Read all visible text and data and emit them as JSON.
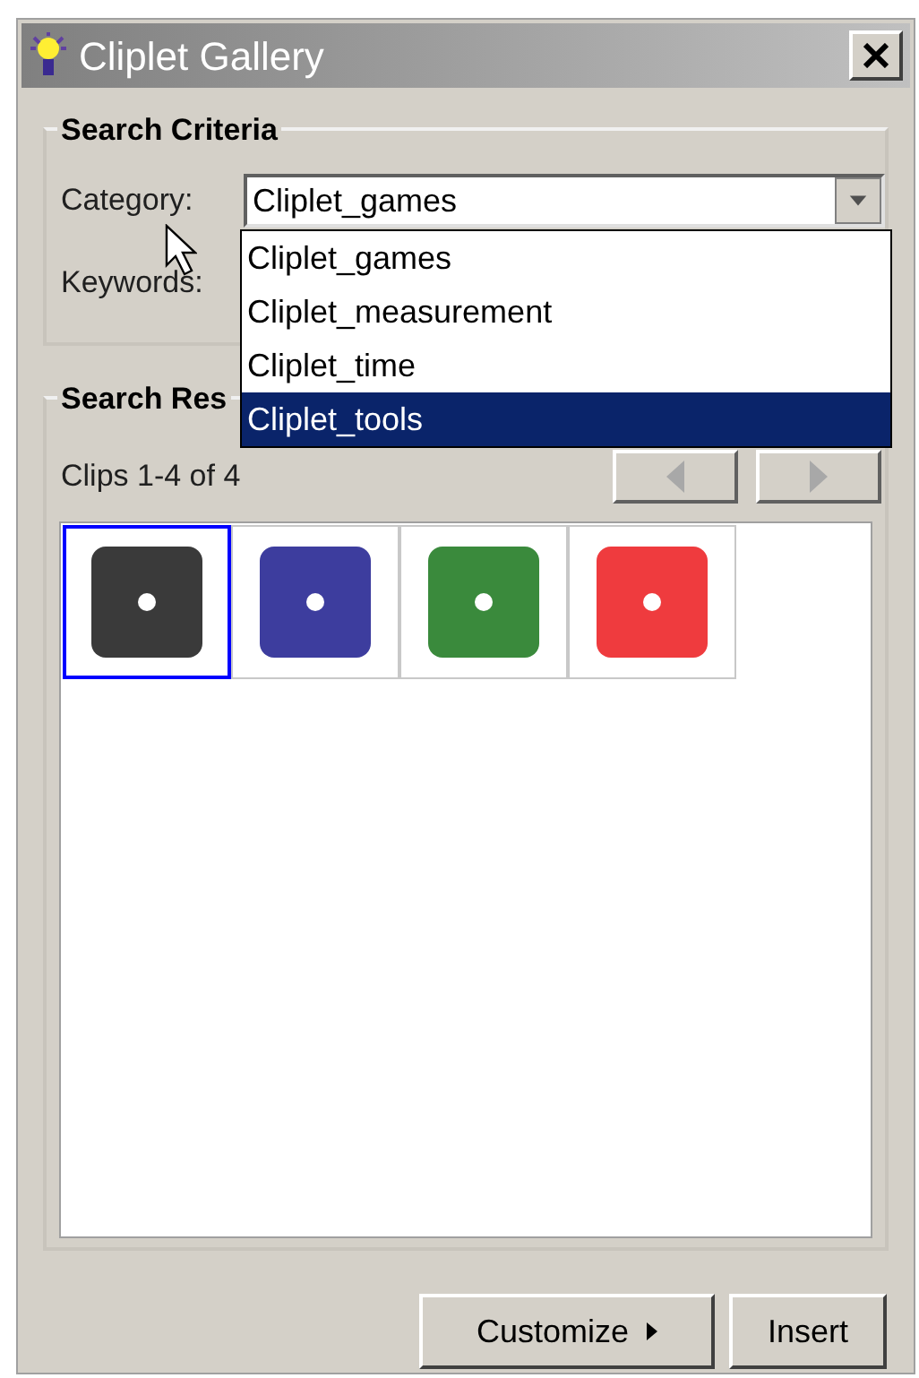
{
  "window": {
    "title": "Cliplet Gallery"
  },
  "search_criteria": {
    "title": "Search Criteria",
    "category_label": "Category:",
    "category_value": "Cliplet_games",
    "keywords_label": "Keywords:",
    "dropdown": [
      {
        "label": "Cliplet_games",
        "selected": false
      },
      {
        "label": "Cliplet_measurement",
        "selected": false
      },
      {
        "label": "Cliplet_time",
        "selected": false
      },
      {
        "label": "Cliplet_tools",
        "selected": true
      }
    ]
  },
  "search_results": {
    "title": "Search Res",
    "count": "Clips 1-4 of 4",
    "clips": [
      {
        "color": "#3a3a3a",
        "selected": true
      },
      {
        "color": "#3d3d9e",
        "selected": false
      },
      {
        "color": "#3a8a3c",
        "selected": false
      },
      {
        "color": "#ef3b3e",
        "selected": false
      }
    ]
  },
  "buttons": [
    {
      "label": "Customize",
      "kind": "menu"
    },
    {
      "label": "Insert",
      "kind": "plain"
    }
  ]
}
